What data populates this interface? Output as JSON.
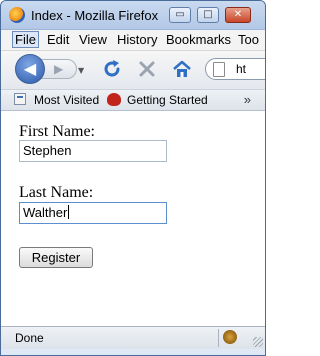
{
  "window": {
    "title": "Index - Mozilla Firefox",
    "controls": {
      "minimize_glyph": "▭",
      "maximize_glyph": "□",
      "close_glyph": "✕"
    }
  },
  "menubar": {
    "items": [
      "File",
      "Edit",
      "View",
      "History",
      "Bookmarks",
      "Too"
    ]
  },
  "navbar": {
    "back_glyph": "◀",
    "forward_glyph": "▶",
    "history_dropdown_glyph": "▼",
    "url_text": "ht"
  },
  "bookmarks": {
    "most_visited": "Most Visited",
    "getting_started": "Getting Started",
    "overflow_glyph": "»"
  },
  "form": {
    "first_name_label": "First Name:",
    "first_name_value": "Stephen",
    "last_name_label": "Last Name:",
    "last_name_value": "Walther",
    "register_label": "Register"
  },
  "status": {
    "text": "Done"
  },
  "colors": {
    "accent": "#2b58a8",
    "reload": "#2f6fc4",
    "stop": "#9aa3b0",
    "home": "#2f6fc4"
  }
}
